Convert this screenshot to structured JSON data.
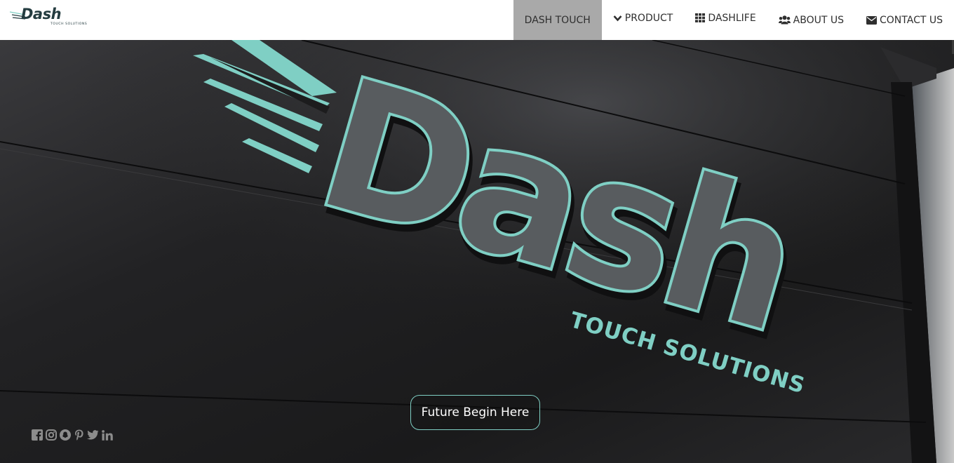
{
  "brand": {
    "logo_text": "Dash",
    "logo_subtext": "TOUCH SOLUTIONS",
    "accent_color": "#7fcfc4",
    "logo_color": "#243c40"
  },
  "nav": {
    "items": [
      {
        "label": "DASH TOUCH",
        "icon": null,
        "active": true
      },
      {
        "label": "PRODUCT",
        "icon": "chevron-down-icon"
      },
      {
        "label": "DASHLIFE",
        "icon": "grid-icon"
      },
      {
        "label": "ABOUT US",
        "icon": "users-icon"
      },
      {
        "label": "CONTACT US",
        "icon": "envelope-icon"
      }
    ]
  },
  "hero": {
    "sign_word": "Dash",
    "sign_subtext": "TOUCH SOLUTIONS",
    "cta_label": "Future Begin Here"
  },
  "social": [
    "facebook-icon",
    "instagram-icon",
    "snapchat-icon",
    "pinterest-icon",
    "twitter-icon",
    "linkedin-icon"
  ]
}
